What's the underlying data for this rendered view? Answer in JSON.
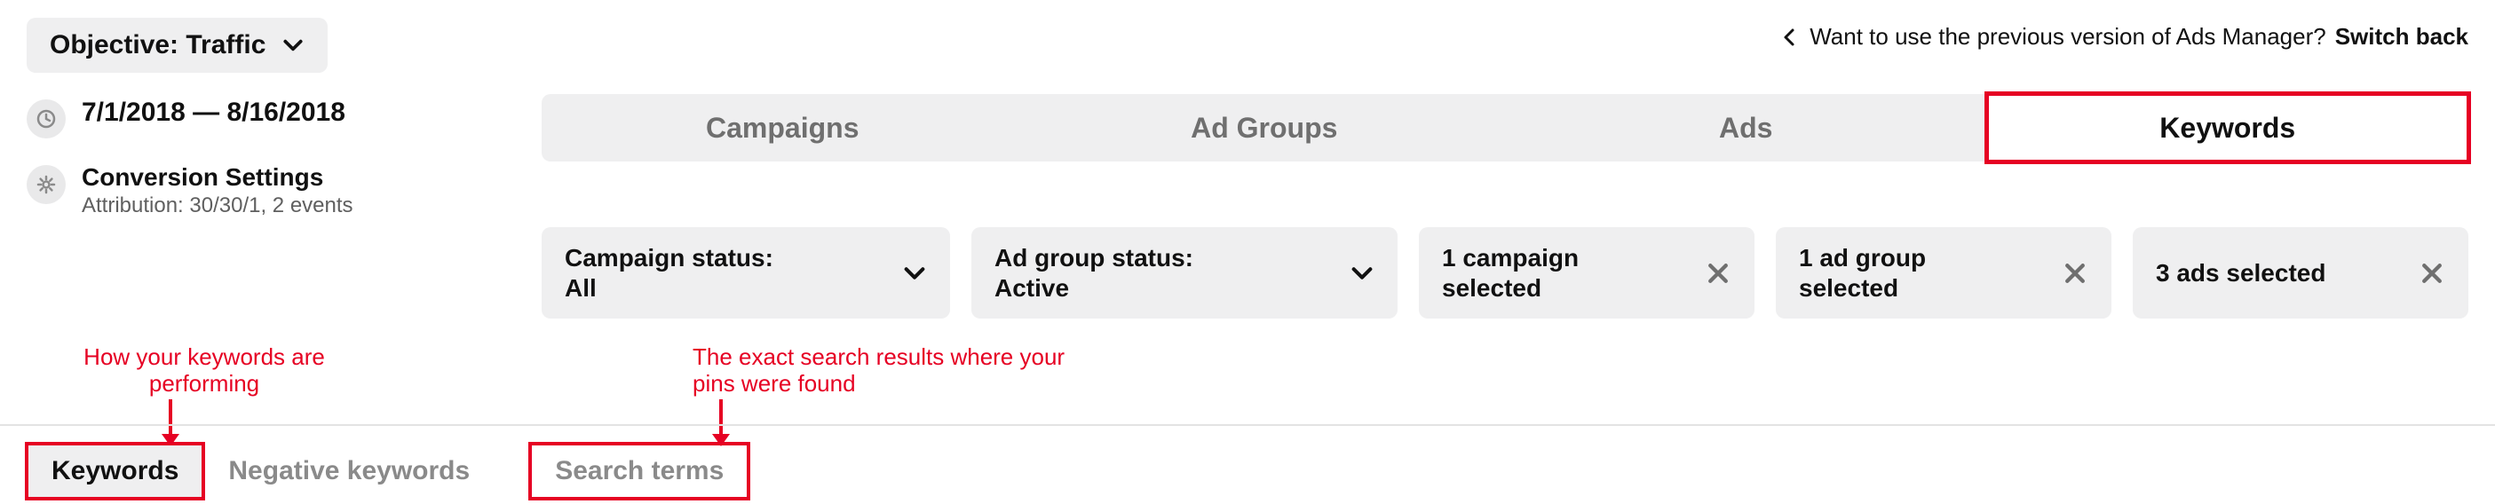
{
  "sidebar": {
    "objective_label": "Objective: Traffic",
    "date_range": "7/1/2018 — 8/16/2018",
    "conversion_title": "Conversion Settings",
    "conversion_sub": "Attribution: 30/30/1, 2 events"
  },
  "switch_back": {
    "question": "Want to use the previous version of Ads Manager?",
    "link": "Switch back"
  },
  "tabs": {
    "campaigns": "Campaigns",
    "ad_groups": "Ad Groups",
    "ads": "Ads",
    "keywords": "Keywords"
  },
  "filters": {
    "campaign_status": {
      "label": "Campaign status:",
      "value": "All"
    },
    "ad_group_status": {
      "label": "Ad group status:",
      "value": "Active"
    },
    "sel_campaign": "1 campaign selected",
    "sel_ad_group": "1 ad group selected",
    "sel_ads": "3 ads selected"
  },
  "subtabs": {
    "keywords": "Keywords",
    "negative": "Negative keywords",
    "search_terms": "Search terms"
  },
  "annotations": {
    "keywords_perf": "How your keywords are performing",
    "search_terms": "The exact search results where your pins were found"
  }
}
